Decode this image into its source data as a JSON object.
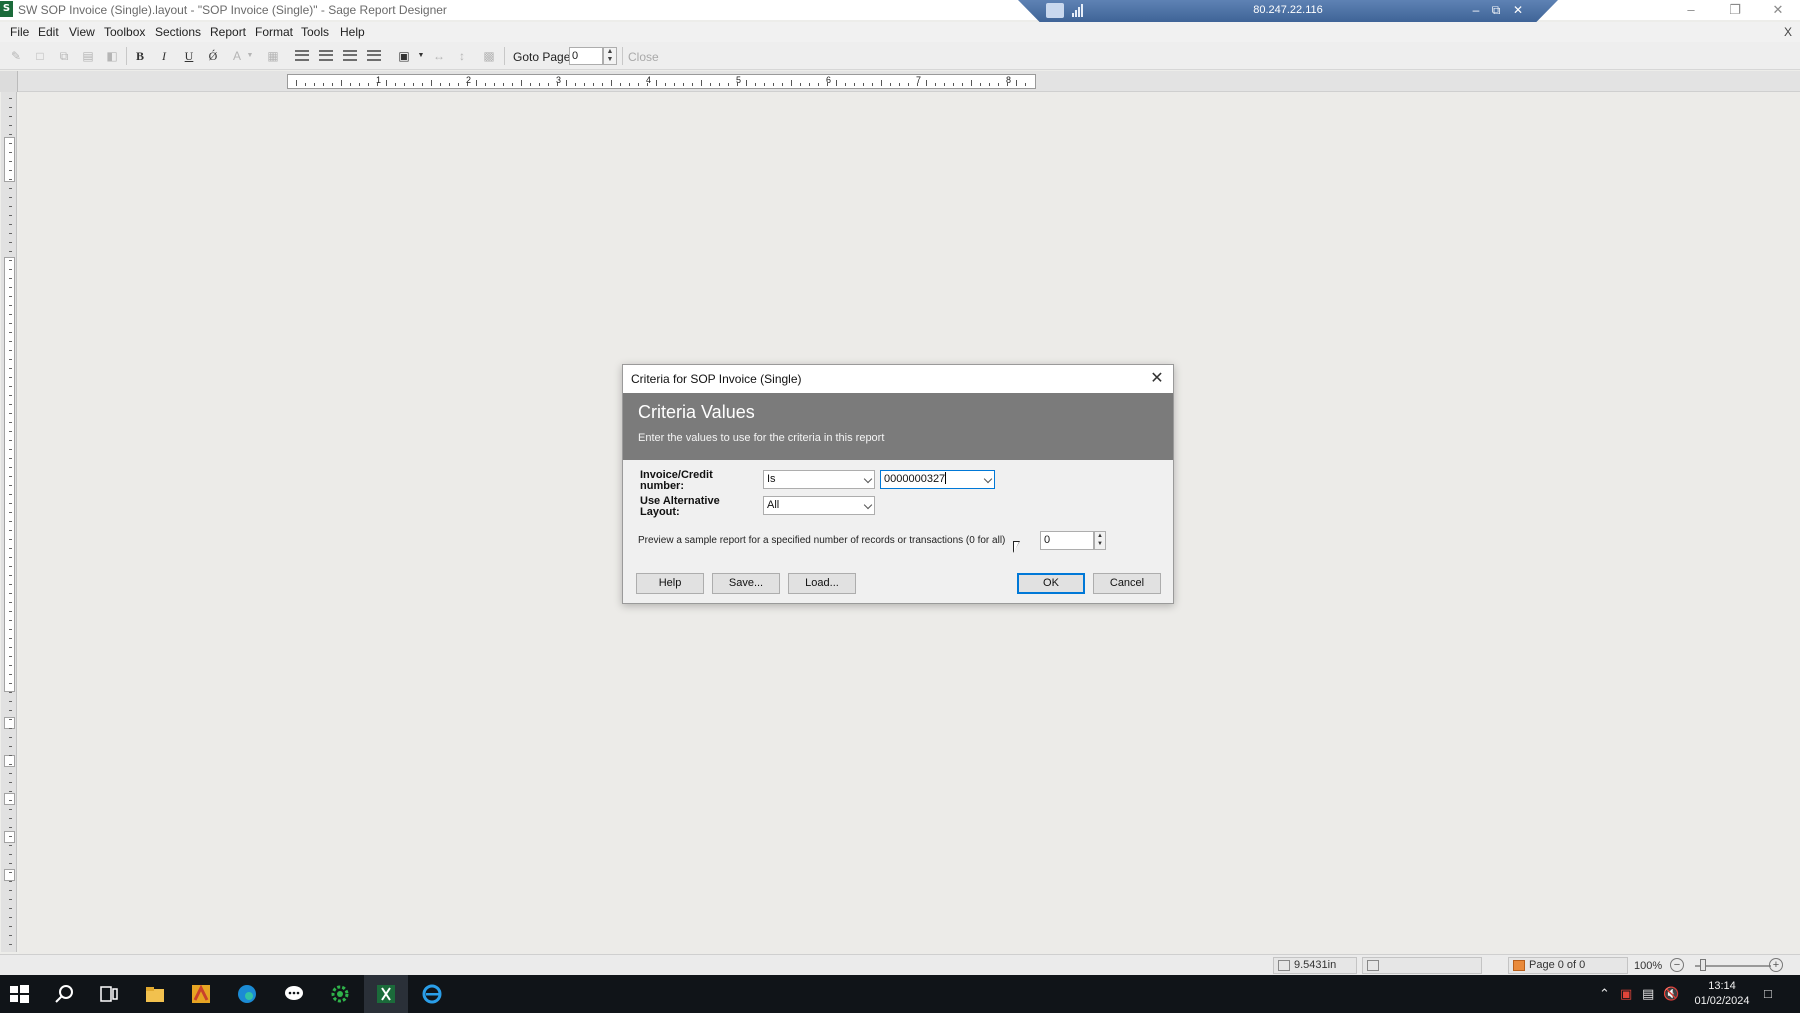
{
  "window": {
    "title": "SW SOP Invoice (Single).layout - \"SOP Invoice (Single)\" - Sage Report Designer",
    "app_icon": "sage-report-designer-icon"
  },
  "rdp": {
    "host": "80.247.22.116"
  },
  "menu": [
    "File",
    "Edit",
    "View",
    "Toolbox",
    "Sections",
    "Report",
    "Format",
    "Tools",
    "Help"
  ],
  "menu_close": "X",
  "toolbar": {
    "bold": "B",
    "italic": "I",
    "underline": "U",
    "strike": "Ǿ",
    "goto_label": "Goto Page",
    "goto_value": "0",
    "close_label": "Close"
  },
  "ruler": {
    "numbers": [
      "1",
      "2",
      "3",
      "4",
      "5",
      "6",
      "7",
      "8"
    ]
  },
  "statusbar": {
    "position": "9.5431in",
    "page": "Page 0 of 0",
    "zoom": "100%"
  },
  "taskbar": {
    "time": "13:14",
    "date": "01/02/2024"
  },
  "dialog": {
    "title": "Criteria for SOP Invoice (Single)",
    "heading": "Criteria Values",
    "subheading": "Enter the values to use for the criteria in this report",
    "criteria": [
      {
        "label": "Invoice/Credit number:",
        "operator": "Is",
        "value": "0000000327"
      },
      {
        "label": "Use Alternative Layout:",
        "operator": "All"
      }
    ],
    "preview_text": "Preview a sample report for a specified number of records or transactions (0 for all)",
    "preview_value": "0",
    "buttons": {
      "help": "Help",
      "save": "Save...",
      "load": "Load...",
      "ok": "OK",
      "cancel": "Cancel"
    }
  },
  "colors": {
    "accent": "#0078d7",
    "header": "#7b7b7b",
    "taskbar": "#101418",
    "rdp": "#4a6ea3"
  }
}
